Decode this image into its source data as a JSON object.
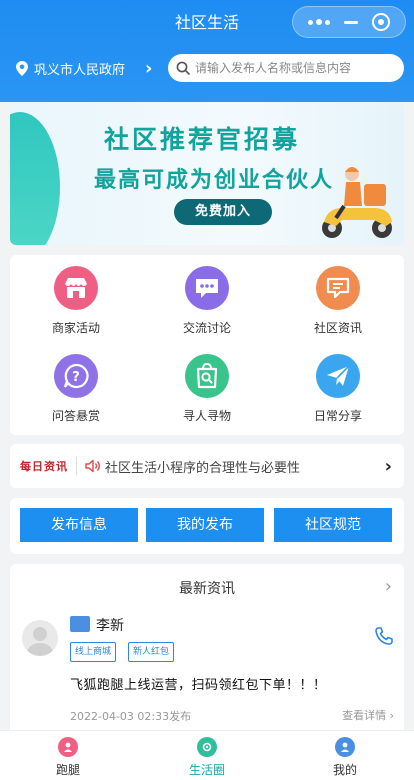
{
  "header": {
    "title": "社区生活"
  },
  "location": {
    "name": "巩义市人民政府"
  },
  "search": {
    "placeholder": "请输入发布人名称或信息内容"
  },
  "banner": {
    "line1": "社区推荐官招募",
    "line2": "最高可成为创业合伙人",
    "button": "免费加入"
  },
  "grid": [
    {
      "label": "商家活动",
      "icon": "shop-icon",
      "color": "#ef5f84"
    },
    {
      "label": "交流讨论",
      "icon": "chat-icon",
      "color": "#8a6be8"
    },
    {
      "label": "社区资讯",
      "icon": "news-icon",
      "color": "#f18c50"
    },
    {
      "label": "问答悬赏",
      "icon": "question-icon",
      "color": "#8f73e6"
    },
    {
      "label": "寻人寻物",
      "icon": "search-bag-icon",
      "color": "#38c48b"
    },
    {
      "label": "日常分享",
      "icon": "paper-plane-icon",
      "color": "#3aa6ef"
    }
  ],
  "notice": {
    "tag": "每日资讯",
    "text": "社区生活小程序的合理性与必要性"
  },
  "actions": [
    "发布信息",
    "我的发布",
    "社区规范"
  ],
  "news": {
    "title": "最新资讯",
    "user": "李新",
    "tags": [
      "线上商城",
      "新人红包"
    ],
    "content": "飞狐跑腿上线运营，扫码领红包下单！！！",
    "date": "2022-04-03 02:33发布",
    "more": "查看详情"
  },
  "tabs": [
    {
      "label": "跑腿",
      "color": "#ef5f84"
    },
    {
      "label": "生活圈",
      "color": "#2fbf9a",
      "active": true
    },
    {
      "label": "我的",
      "color": "#4a90e2"
    }
  ]
}
